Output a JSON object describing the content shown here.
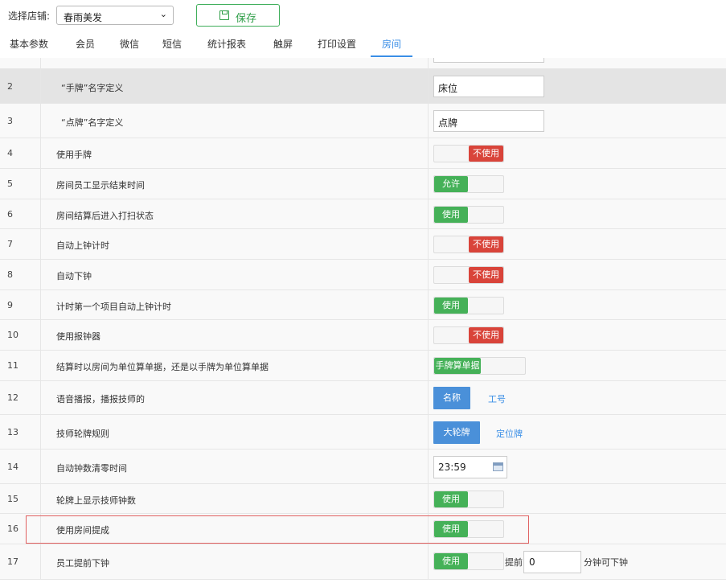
{
  "toolbar": {
    "store_label": "选择店铺:",
    "store_selected": "春雨美发",
    "save_label": "保存"
  },
  "tabs": [
    {
      "label": "基本参数",
      "active": false
    },
    {
      "label": "会员",
      "active": false
    },
    {
      "label": "微信",
      "active": false
    },
    {
      "label": "短信",
      "active": false
    },
    {
      "label": "统计报表",
      "active": false
    },
    {
      "label": "触屏",
      "active": false
    },
    {
      "label": "打印设置",
      "active": false
    },
    {
      "label": "房间",
      "active": true
    }
  ],
  "rows": [
    {
      "idx": "2",
      "label": "“手牌”名字定义",
      "control": "text",
      "value": "床位"
    },
    {
      "idx": "3",
      "label": "“点牌”名字定义",
      "control": "text",
      "value": "点牌"
    },
    {
      "idx": "4",
      "label": "使用手牌",
      "control": "switch",
      "state": "off",
      "text": "不使用"
    },
    {
      "idx": "5",
      "label": "房间员工显示结束时间",
      "control": "switch",
      "state": "on",
      "text": "允许"
    },
    {
      "idx": "6",
      "label": "房间结算后进入打扫状态",
      "control": "switch",
      "state": "on",
      "text": "使用"
    },
    {
      "idx": "7",
      "label": "自动上钟计时",
      "control": "switch",
      "state": "off",
      "text": "不使用"
    },
    {
      "idx": "8",
      "label": "自动下钟",
      "control": "switch",
      "state": "off",
      "text": "不使用"
    },
    {
      "idx": "9",
      "label": "计时第一个项目自动上钟计时",
      "control": "switch",
      "state": "on",
      "text": "使用"
    },
    {
      "idx": "10",
      "label": "使用报钟器",
      "control": "switch",
      "state": "off",
      "text": "不使用"
    },
    {
      "idx": "11",
      "label": "结算时以房间为单位算单据，还是以手牌为单位算单据",
      "control": "switch",
      "state": "on",
      "text": "手牌算单据"
    },
    {
      "idx": "12",
      "label": "语音播报，播报技师的",
      "control": "options",
      "selected": "名称",
      "other": "工号"
    },
    {
      "idx": "13",
      "label": "技师轮牌规则",
      "control": "options",
      "selected": "大轮牌",
      "other": "定位牌"
    },
    {
      "idx": "14",
      "label": "自动钟数清零时间",
      "control": "time",
      "value": "23:59"
    },
    {
      "idx": "15",
      "label": "轮牌上显示技师钟数",
      "control": "switch",
      "state": "on",
      "text": "使用"
    },
    {
      "idx": "16",
      "label": "使用房间提成",
      "control": "switch",
      "state": "on",
      "text": "使用"
    },
    {
      "idx": "17",
      "label": "员工提前下钟",
      "control": "switch",
      "state": "on",
      "text": "使用",
      "prefix": "提前",
      "number": "0",
      "suffix": "分钟可下钟"
    }
  ],
  "colors": {
    "accent": "#3a8ee6",
    "switch_on": "#45b158",
    "switch_off": "#d9443a",
    "option_selected": "#4a90d9",
    "save_green": "#2f9e48",
    "highlight_border": "#e06060"
  }
}
